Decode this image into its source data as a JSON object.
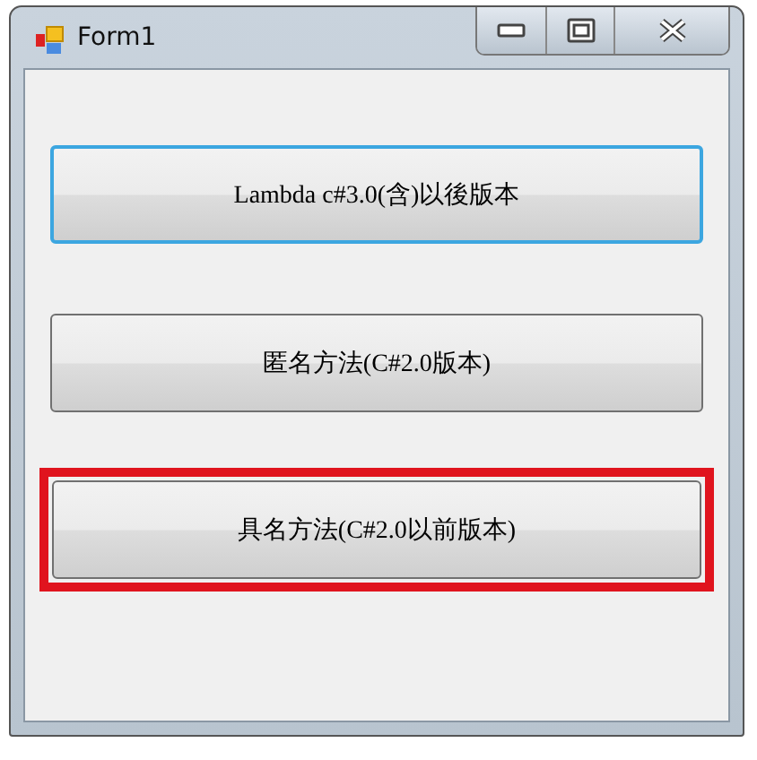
{
  "window": {
    "title": "Form1"
  },
  "buttons": [
    {
      "label": "Lambda c#3.0(含)以後版本",
      "focused": true,
      "highlighted": false
    },
    {
      "label": "匿名方法(C#2.0版本)",
      "focused": false,
      "highlighted": false
    },
    {
      "label": "具名方法(C#2.0以前版本)",
      "focused": false,
      "highlighted": true
    }
  ]
}
